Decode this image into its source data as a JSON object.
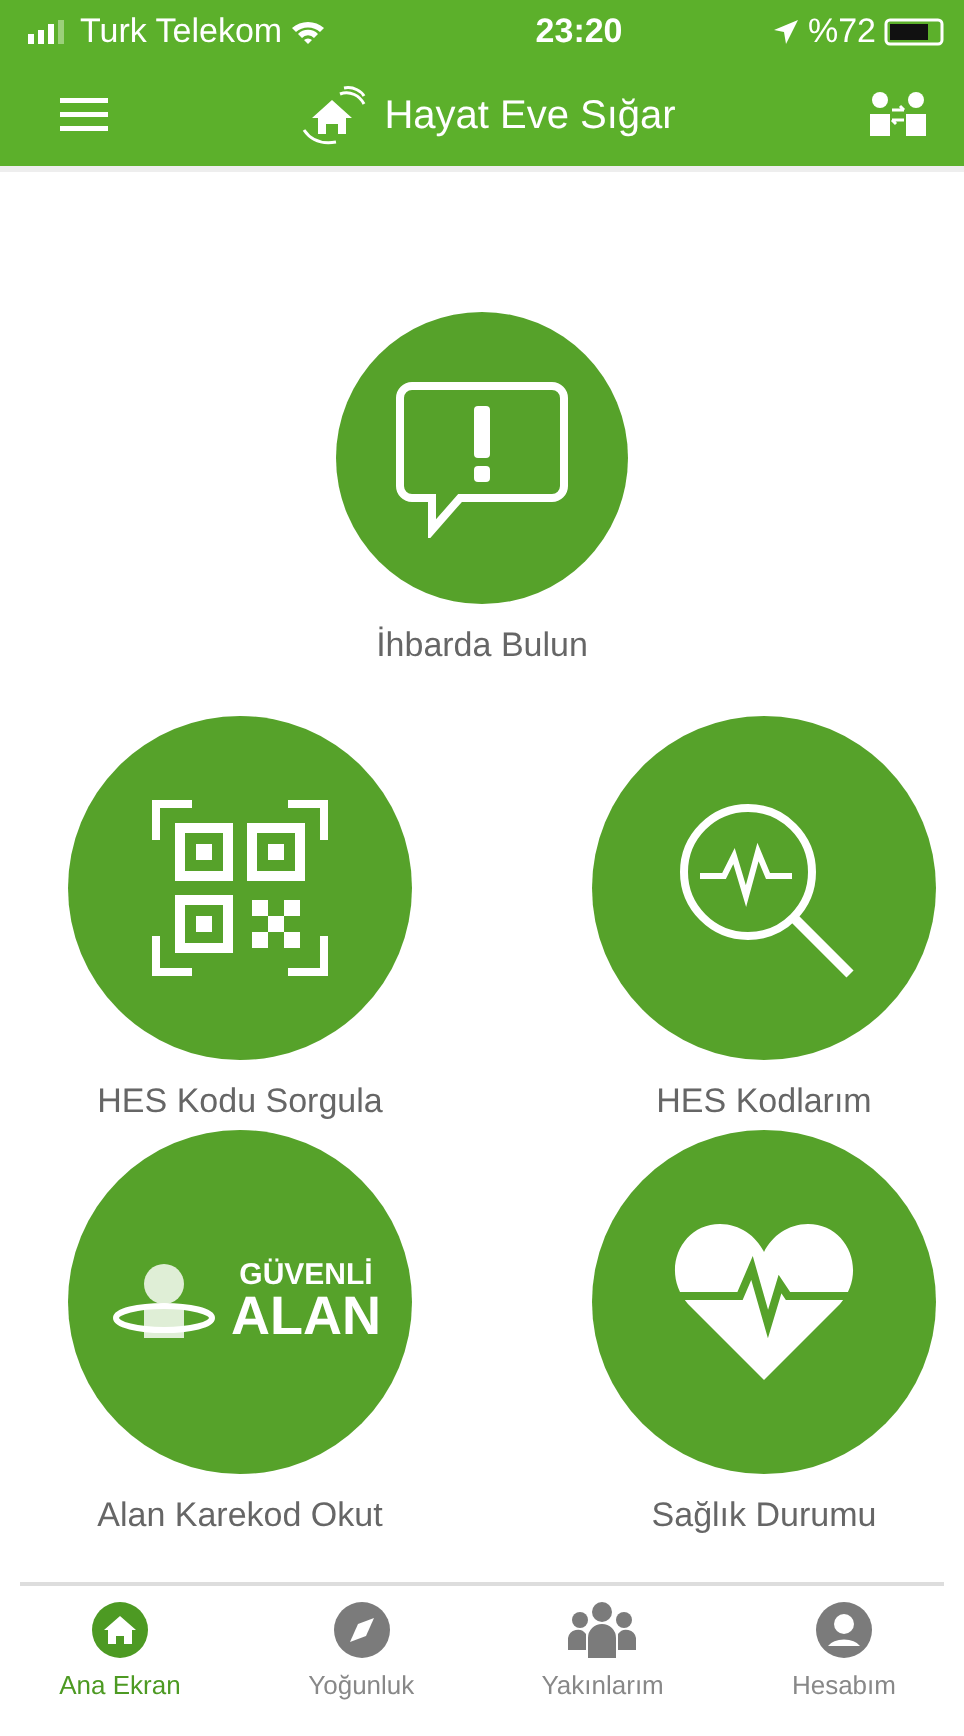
{
  "status_bar": {
    "carrier": "Turk Telekom",
    "time": "23:20",
    "battery": "%72"
  },
  "header": {
    "title": "Hayat Eve Sığar"
  },
  "tiles": [
    {
      "kind": "report",
      "label": "İhbarda Bulun"
    },
    {
      "kind": "qr",
      "label": "HES Kodu Sorgula"
    },
    {
      "kind": "search",
      "label": "HES Kodlarım"
    },
    {
      "kind": "logo",
      "label": "Alan Karekod Okut",
      "logo_top": "GÜVENLİ",
      "logo_bottom": "ALAN"
    },
    {
      "kind": "heart",
      "label": "Sağlık Durumu"
    }
  ],
  "tab_bar": [
    {
      "kind": "home",
      "label": "Ana Ekran",
      "selected": true
    },
    {
      "kind": "compass",
      "label": "Yoğunluk",
      "selected": false
    },
    {
      "kind": "group",
      "label": "Yakınlarım",
      "selected": false
    },
    {
      "kind": "user",
      "label": "Hesabım",
      "selected": false
    }
  ]
}
